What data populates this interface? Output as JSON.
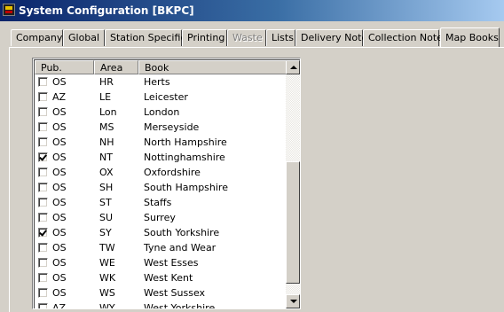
{
  "window": {
    "title": "System Configuration [BKPC]"
  },
  "tabs": [
    {
      "label": "Company"
    },
    {
      "label": "Global"
    },
    {
      "label": "Station Specific"
    },
    {
      "label": "Printing"
    },
    {
      "label": "Waste"
    },
    {
      "label": "Lists"
    },
    {
      "label": "Delivery Note"
    },
    {
      "label": "Collection Note"
    },
    {
      "label": "Map Books"
    }
  ],
  "table": {
    "columns": [
      "Pub.",
      "Area",
      "Book"
    ],
    "rows": [
      {
        "checked": false,
        "pub": "OS",
        "area": "HR",
        "book": "Herts"
      },
      {
        "checked": false,
        "pub": "AZ",
        "area": "LE",
        "book": "Leicester"
      },
      {
        "checked": false,
        "pub": "OS",
        "area": "Lon",
        "book": "London"
      },
      {
        "checked": false,
        "pub": "OS",
        "area": "MS",
        "book": "Merseyside"
      },
      {
        "checked": false,
        "pub": "OS",
        "area": "NH",
        "book": "North Hampshire"
      },
      {
        "checked": true,
        "pub": "OS",
        "area": "NT",
        "book": "Nottinghamshire"
      },
      {
        "checked": false,
        "pub": "OS",
        "area": "OX",
        "book": "Oxfordshire"
      },
      {
        "checked": false,
        "pub": "OS",
        "area": "SH",
        "book": "South Hampshire"
      },
      {
        "checked": false,
        "pub": "OS",
        "area": "ST",
        "book": "Staffs"
      },
      {
        "checked": false,
        "pub": "OS",
        "area": "SU",
        "book": "Surrey"
      },
      {
        "checked": true,
        "pub": "OS",
        "area": "SY",
        "book": "South Yorkshire"
      },
      {
        "checked": false,
        "pub": "OS",
        "area": "TW",
        "book": "Tyne and Wear"
      },
      {
        "checked": false,
        "pub": "OS",
        "area": "WE",
        "book": "West Esses"
      },
      {
        "checked": false,
        "pub": "OS",
        "area": "WK",
        "book": "West Kent"
      },
      {
        "checked": false,
        "pub": "OS",
        "area": "WS",
        "book": "West Sussex"
      },
      {
        "checked": false,
        "pub": "AZ",
        "area": "WY",
        "book": "West Yorkshire"
      }
    ]
  },
  "colors": {
    "titlebar_start": "#0a246a",
    "titlebar_end": "#a6caf0",
    "face": "#d4d0c8"
  },
  "icons": {
    "app": "app-icon",
    "scroll_up": "scroll-up-arrow-icon",
    "scroll_down": "scroll-down-arrow-icon"
  }
}
